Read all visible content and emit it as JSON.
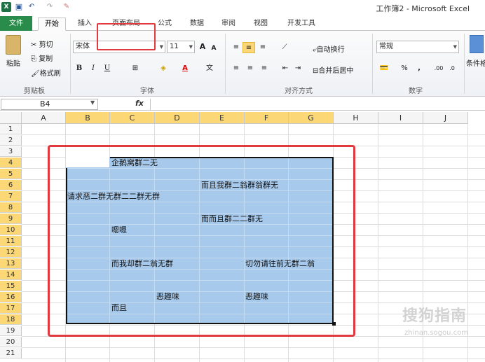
{
  "window": {
    "title": "工作簿2 - Microsoft Excel"
  },
  "tabs": [
    "文件",
    "开始",
    "插入",
    "页面布局",
    "公式",
    "数据",
    "审阅",
    "视图",
    "开发工具"
  ],
  "clipboard": {
    "paste": "粘贴",
    "cut": "剪切",
    "copy": "复制",
    "format_painter": "格式刷",
    "group": "剪贴板"
  },
  "font": {
    "name": "宋体",
    "size": "11",
    "bold": "B",
    "italic": "I",
    "underline": "U",
    "group": "字体",
    "grow": "A",
    "shrink": "A",
    "wen": "文"
  },
  "alignment": {
    "wrap": "自动换行",
    "merge": "合并后居中",
    "group": "对齐方式"
  },
  "number": {
    "format": "常规",
    "percent": "%",
    "comma": ",",
    "inc": ".00",
    "dec": ".0",
    "group": "数字"
  },
  "styles": {
    "conditional": "条件格"
  },
  "formula_bar": {
    "name_box": "B4",
    "fx": "fx"
  },
  "columns": [
    "A",
    "B",
    "C",
    "D",
    "E",
    "F",
    "G",
    "H",
    "I",
    "J"
  ],
  "rows": [
    "1",
    "2",
    "3",
    "4",
    "5",
    "6",
    "7",
    "8",
    "9",
    "10",
    "11",
    "12",
    "13",
    "14",
    "15",
    "16",
    "17",
    "18",
    "19",
    "20",
    "21"
  ],
  "cells": {
    "C4": "企鹅窝群二无",
    "E6": "而且我群二翁群翁群无",
    "B7": "请求恶二群无群二二群无群",
    "E9": "而而且群二二群无",
    "C10": "嗯嗯",
    "C13": "而我却群二翁无群",
    "F13": "切勿请往前无群二翁",
    "D16": "恶趣味",
    "F16": "恶趣味",
    "C17": "而且"
  },
  "watermark": {
    "main": "搜狗指南",
    "sub": "zhinan.sogou.com"
  }
}
